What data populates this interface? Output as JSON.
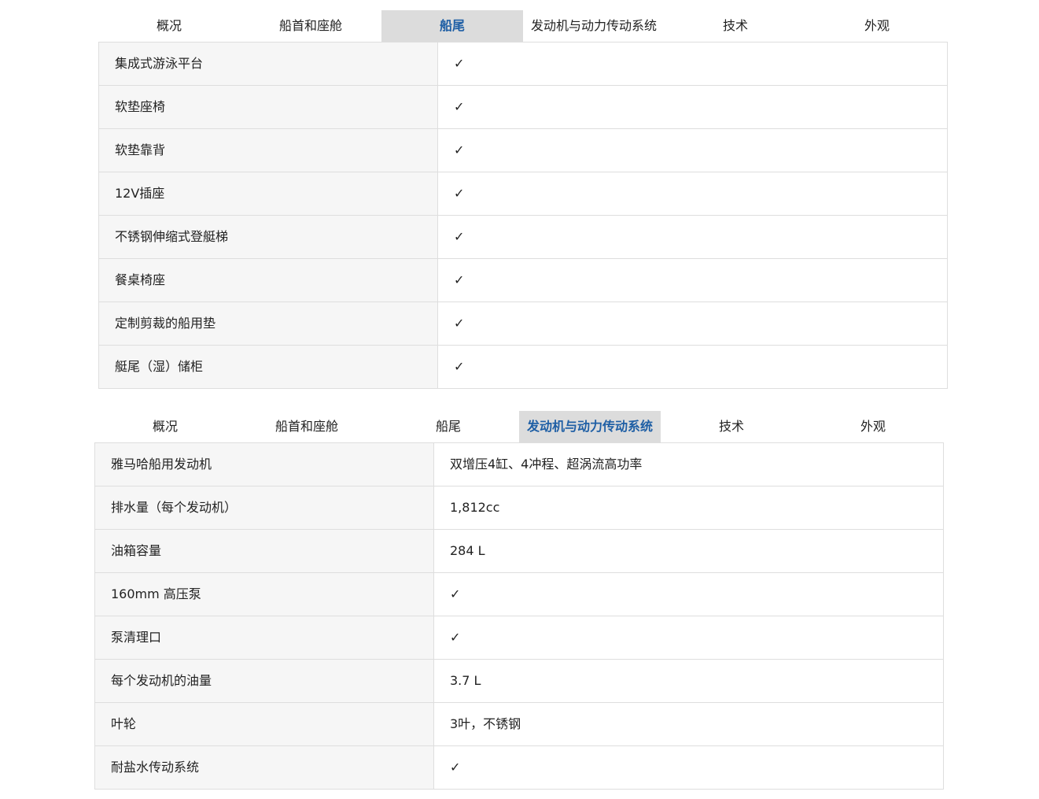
{
  "section_a": {
    "tabs": [
      {
        "label": "概况"
      },
      {
        "label": "船首和座舱"
      },
      {
        "label": "船尾"
      },
      {
        "label": "发动机与动力传动系统"
      },
      {
        "label": "技术"
      },
      {
        "label": "外观"
      }
    ],
    "active_tab": "船尾",
    "rows": [
      {
        "label": "集成式游泳平台",
        "value": "✓"
      },
      {
        "label": "软垫座椅",
        "value": "✓"
      },
      {
        "label": "软垫靠背",
        "value": "✓"
      },
      {
        "label": "12V插座",
        "value": "✓"
      },
      {
        "label": "不锈钢伸缩式登艇梯",
        "value": "✓"
      },
      {
        "label": "餐桌椅座",
        "value": "✓"
      },
      {
        "label": "定制剪裁的船用垫",
        "value": "✓"
      },
      {
        "label": "艇尾（湿）储柜",
        "value": "✓"
      }
    ]
  },
  "section_b": {
    "tabs": [
      {
        "label": "概况"
      },
      {
        "label": "船首和座舱"
      },
      {
        "label": "船尾"
      },
      {
        "label": "发动机与动力传动系统"
      },
      {
        "label": "技术"
      },
      {
        "label": "外观"
      }
    ],
    "active_tab": "发动机与动力传动系统",
    "rows": [
      {
        "label": "雅马哈船用发动机",
        "value": "双增压4缸、4冲程、超涡流高功率"
      },
      {
        "label": "排水量（每个发动机）",
        "value": "1,812cc"
      },
      {
        "label": "油箱容量",
        "value": "284 L"
      },
      {
        "label": "160mm 高压泵",
        "value": "✓"
      },
      {
        "label": "泵清理口",
        "value": "✓"
      },
      {
        "label": "每个发动机的油量",
        "value": "3.7 L"
      },
      {
        "label": "叶轮",
        "value": "3叶，不锈钢"
      },
      {
        "label": "耐盐水传动系统",
        "value": "✓"
      }
    ]
  },
  "colors": {
    "active_tab_bg": "#dcdcdc",
    "active_tab_text": "#1f5fa5",
    "label_cell_bg": "#f6f6f6",
    "border": "#dedede"
  }
}
